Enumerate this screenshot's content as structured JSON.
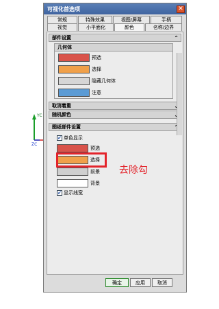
{
  "dialog": {
    "title": "可视化首选项",
    "close": "✕",
    "tabs_row1": [
      "常规",
      "特殊效果",
      "视图/屏幕",
      "手柄"
    ],
    "tabs_row2": [
      "视觉",
      "小平面化",
      "颜色",
      "名称/边界"
    ],
    "active_tab": "颜色"
  },
  "part_settings": {
    "title": "部件设置",
    "geometry_group": {
      "title": "几何体",
      "colors": [
        {
          "label": "预选",
          "color": "#d9534a"
        },
        {
          "label": "选择",
          "color": "#f0a04a"
        },
        {
          "label": "隐藏几何体",
          "color": "#d6d6d6"
        },
        {
          "label": "注意",
          "color": "#5b9bd5"
        }
      ]
    }
  },
  "collapsed_sections": [
    "取消着重",
    "随机颜色"
  ],
  "drawing_settings": {
    "title": "图纸部件设置",
    "monochrome_label": "单色显示",
    "monochrome_checked": true,
    "colors": [
      {
        "label": "预选",
        "color": "#d9534a"
      },
      {
        "label": "选择",
        "color": "#f0a04a"
      },
      {
        "label": "前景",
        "color": "#cfcfcf"
      },
      {
        "label": "背景",
        "color": "#ffffff"
      }
    ],
    "line_width_label": "显示线宽",
    "line_width_checked": true
  },
  "annotation_text": "去除勾",
  "axes": {
    "y": "YC",
    "z": "ZC"
  },
  "buttons": {
    "ok": "确定",
    "apply": "应用",
    "cancel": "取消"
  }
}
